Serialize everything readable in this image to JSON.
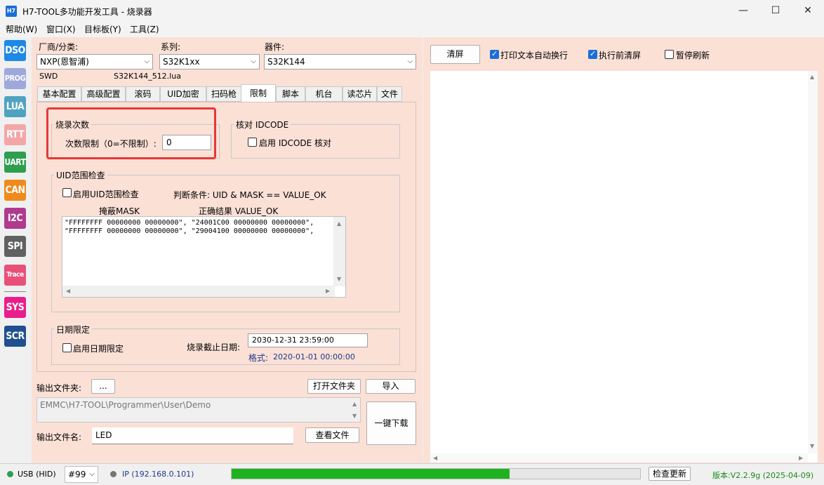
{
  "window": {
    "title": "H7-TOOL多功能开发工具 - 烧录器",
    "app_icon": "H7",
    "minimize_icon": "—",
    "maximize_icon": "☐",
    "close_icon": "✕"
  },
  "menu": [
    "帮助(W)",
    "窗口(X)",
    "目标板(Y)",
    "工具(Z)"
  ],
  "toolbar": [
    {
      "label": "DSO",
      "color": "#1e88e5"
    },
    {
      "label": "PROG",
      "color": "#9fa8da"
    },
    {
      "label": "LUA",
      "color": "#4fa3c0"
    },
    {
      "label": "RTT",
      "color": "#f4a6a6"
    },
    {
      "label": "UART",
      "color": "#2e9e4f"
    },
    {
      "label": "CAN",
      "color": "#f08a1c"
    },
    {
      "label": "I2C",
      "color": "#b03a8e"
    },
    {
      "label": "SPI",
      "color": "#616161"
    },
    {
      "label": "Trace",
      "color": "#e8507a"
    },
    {
      "label": "SYS",
      "color": "#e91e8c"
    },
    {
      "label": "SCR",
      "color": "#1f4f8f"
    }
  ],
  "selectors": {
    "vendor_label": "厂商/分类:",
    "vendor_value": "NXP(恩智浦)",
    "series_label": "系列:",
    "series_value": "S32K1xx",
    "device_label": "器件:",
    "device_value": "S32K144",
    "interface": "SWD",
    "lua_file": "S32K144_512.lua"
  },
  "tabs": [
    "基本配置",
    "高级配置",
    "滚码",
    "UID加密",
    "扫码枪",
    "限制",
    "脚本",
    "机台",
    "读芯片",
    "文件"
  ],
  "limit": {
    "burn_count_title": "烧录次数",
    "burn_count_label": "次数限制（0=不限制）:",
    "burn_count_value": "0",
    "idcode_title": "核对 IDCODE",
    "idcode_enable": "启用 IDCODE 核对",
    "uid_title": "UID范围检查",
    "uid_enable": "启用UID范围检查",
    "uid_condition": "判断条件: UID & MASK ==  VALUE_OK",
    "mask_header": "掩蔽MASK",
    "value_header": "正确结果 VALUE_OK",
    "uid_lines": [
      "\"FFFFFFFF 00000000 00000000\", \"24001C00 00000000 00000000\",",
      "\"FFFFFFFF 00000000 00000000\", \"29004100 00000000 00000000\","
    ],
    "date_title": "日期限定",
    "date_enable": "启用日期限定",
    "deadline_label": "烧录截止日期:",
    "deadline_value": "2030-12-31  23:59:00",
    "format_label": "格式:",
    "format_value": "2020-01-01 00:00:00"
  },
  "output": {
    "folder_label": "输出文件夹:",
    "browse_button": "...",
    "open_folder_button": "打开文件夹",
    "import_button": "导入",
    "path": "EMMC\\H7-TOOL\\Programmer\\User\\Demo",
    "filename_label": "输出文件名:",
    "filename_value": "LED",
    "view_file_button": "查看文件",
    "download_button": "一键下载"
  },
  "log": {
    "clear_button": "清屏",
    "autowrap_label": "打印文本自动换行",
    "clear_before_label": "执行前清屏",
    "pause_label": "暂停刷新"
  },
  "status": {
    "usb_label": "USB (HID)",
    "usb_color": "#2e9e4f",
    "device_no": "#99",
    "ip_label": "IP (192.168.0.101)",
    "ip_color": "#757575",
    "progress": 0.68,
    "progress_color": "#1db320",
    "check_update_button": "检查更新",
    "version": "版本:V2.2.9g (2025-04-09)",
    "version_color": "#1a8a1a"
  }
}
